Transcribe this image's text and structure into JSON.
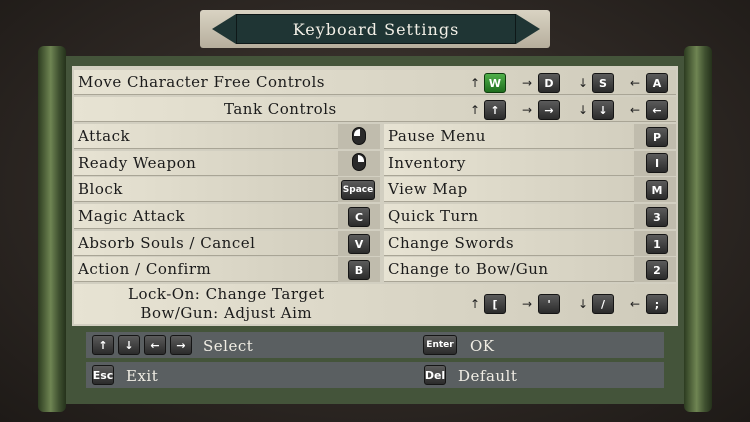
{
  "title": "Keyboard Settings",
  "movement": {
    "free_label": "Move Character Free Controls",
    "tank_label": "Tank Controls",
    "free_keys": [
      "W",
      "D",
      "S",
      "A"
    ],
    "tank_keys": [
      "↑",
      "→",
      "↓",
      "←"
    ],
    "dir_arrows": [
      "↑",
      "→",
      "↓",
      "←"
    ]
  },
  "left_actions": [
    {
      "label": "Attack",
      "key": ""
    },
    {
      "label": "Ready Weapon",
      "key": ""
    },
    {
      "label": "Block",
      "key": "Space"
    },
    {
      "label": "Magic Attack",
      "key": "C"
    },
    {
      "label": "Absorb Souls / Cancel",
      "key": "V"
    },
    {
      "label": "Action / Confirm",
      "key": "B"
    }
  ],
  "right_actions": [
    {
      "label": "Pause Menu",
      "key": "P"
    },
    {
      "label": "Inventory",
      "key": "I"
    },
    {
      "label": "View Map",
      "key": "M"
    },
    {
      "label": "Quick Turn",
      "key": "3"
    },
    {
      "label": "Change Swords",
      "key": "1"
    },
    {
      "label": "Change to Bow/Gun",
      "key": "2"
    }
  ],
  "lockon": {
    "line1": "Lock-On: Change Target",
    "line2": "Bow/Gun: Adjust Aim",
    "keys": [
      "[",
      "'",
      "/",
      ";"
    ]
  },
  "footer": {
    "select_keys": [
      "↑",
      "↓",
      "←",
      "→"
    ],
    "select_label": "Select",
    "ok_key": "Enter",
    "ok_label": "OK",
    "exit_key": "Esc",
    "exit_label": "Exit",
    "default_key": "Del",
    "default_label": "Default"
  },
  "colors": {
    "highlight": "#3f9b3a",
    "banner": "#1f3534",
    "panel": "#44543a"
  }
}
